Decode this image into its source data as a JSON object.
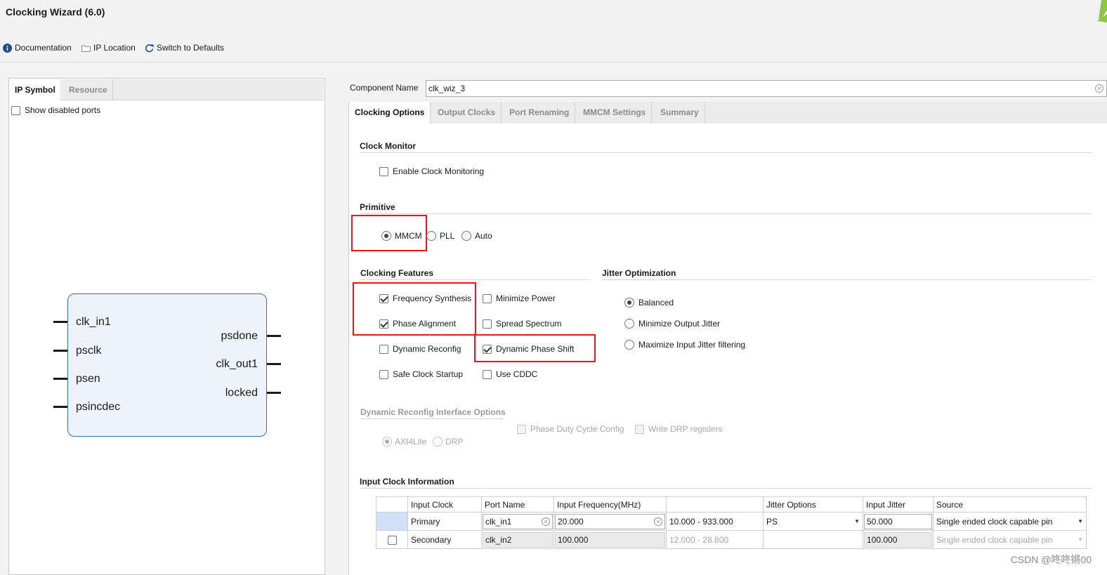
{
  "app": {
    "title": "Clocking Wizard (6.0)"
  },
  "toolbar": {
    "documentation": "Documentation",
    "ip_location": "IP Location",
    "switch_defaults": "Switch to Defaults"
  },
  "left": {
    "tabs": [
      "IP Symbol",
      "Resource"
    ],
    "show_disabled_ports": "Show disabled ports",
    "inputs": [
      "clk_in1",
      "psclk",
      "psen",
      "psincdec"
    ],
    "outputs": [
      "psdone",
      "clk_out1",
      "locked"
    ]
  },
  "component": {
    "label": "Component Name",
    "value": "clk_wiz_3"
  },
  "tabs": [
    "Clocking Options",
    "Output Clocks",
    "Port Renaming",
    "MMCM Settings",
    "Summary"
  ],
  "clock_monitor": {
    "title": "Clock Monitor",
    "enable": "Enable Clock Monitoring"
  },
  "primitive": {
    "title": "Primitive",
    "options": [
      "MMCM",
      "PLL",
      "Auto"
    ],
    "selected": "MMCM"
  },
  "features": {
    "title": "Clocking Features",
    "col1": [
      {
        "label": "Frequency Synthesis",
        "checked": true
      },
      {
        "label": "Phase Alignment",
        "checked": true
      },
      {
        "label": "Dynamic Reconfig",
        "checked": false
      },
      {
        "label": "Safe Clock Startup",
        "checked": false
      }
    ],
    "col2": [
      {
        "label": "Minimize Power",
        "checked": false
      },
      {
        "label": "Spread Spectrum",
        "checked": false
      },
      {
        "label": "Dynamic Phase Shift",
        "checked": true
      },
      {
        "label": "Use CDDC",
        "checked": false
      }
    ]
  },
  "jitter": {
    "title": "Jitter Optimization",
    "options": [
      "Balanced",
      "Minimize Output Jitter",
      "Maximize Input Jitter filtering"
    ],
    "selected": "Balanced"
  },
  "drp": {
    "title": "Dynamic Reconfig Interface Options",
    "interfaces": [
      "AXI4Lite",
      "DRP"
    ],
    "phase_duty": "Phase Duty Cycle Config",
    "write_drp": "Write DRP registers"
  },
  "input_clock": {
    "title": "Input Clock Information",
    "headers": [
      "Input Clock",
      "Port Name",
      "Input Frequency(MHz)",
      "",
      "Jitter Options",
      "Input Jitter",
      "Source"
    ],
    "primary": {
      "name": "Primary",
      "port": "clk_in1",
      "freq": "20.000",
      "range": "10.000 - 933.000",
      "jitter_opt": "PS",
      "jitter": "50.000",
      "source": "Single ended clock capable pin"
    },
    "secondary": {
      "name": "Secondary",
      "port": "clk_in2",
      "freq": "100.000",
      "range": "12.000 - 28.800",
      "jitter": "100.000",
      "source": "Single ended clock capable pin"
    }
  },
  "watermark": "CSDN @咚咚锵00",
  "colors": {
    "highlight": "#e8161b",
    "accent": "#3a6ea5",
    "logo": "#8dc63f"
  }
}
